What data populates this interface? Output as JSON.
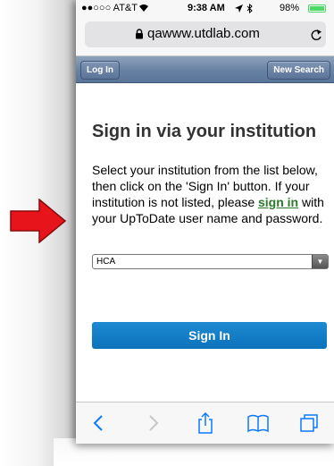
{
  "status_bar": {
    "carrier": "●●○○○ AT&T",
    "time": "9:38 AM",
    "battery_text": "98%",
    "battery_level": 0.98,
    "icons": [
      "wifi-icon",
      "location-icon",
      "bluetooth-icon",
      "battery-icon"
    ]
  },
  "browser": {
    "url": "qawww.utdlab.com",
    "icons": [
      "lock-icon",
      "reload-icon"
    ]
  },
  "nav": {
    "login_label": "Log In",
    "new_search_label": "New Search"
  },
  "main": {
    "heading": "Sign in via your institution",
    "instructions_before": "Select your institution from the list below, then click on the 'Sign In' button. If your institution is not listed, please ",
    "signin_link": "sign in",
    "instructions_after": " with your UpToDate user name and password.",
    "institution_selected": "HCA",
    "signin_button": "Sign In"
  },
  "toolbar": {
    "icons": [
      "back-icon",
      "forward-icon",
      "share-icon",
      "bookmarks-icon",
      "tabs-icon"
    ]
  },
  "colors": {
    "pointer_arrow": "#e8141b",
    "link_green": "#2a7a2a",
    "button_blue": "#1580c8",
    "safari_blue": "#0a7aff"
  }
}
